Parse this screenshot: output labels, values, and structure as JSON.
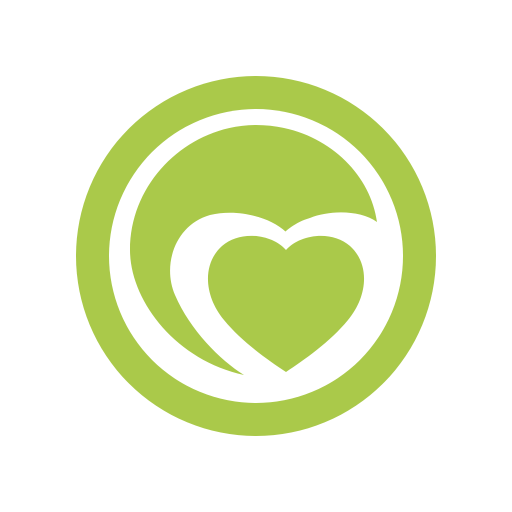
{
  "logo": {
    "icon": "heart-in-circle-icon",
    "colors": {
      "primary": "#aac94a",
      "background": "#ffffff"
    }
  }
}
